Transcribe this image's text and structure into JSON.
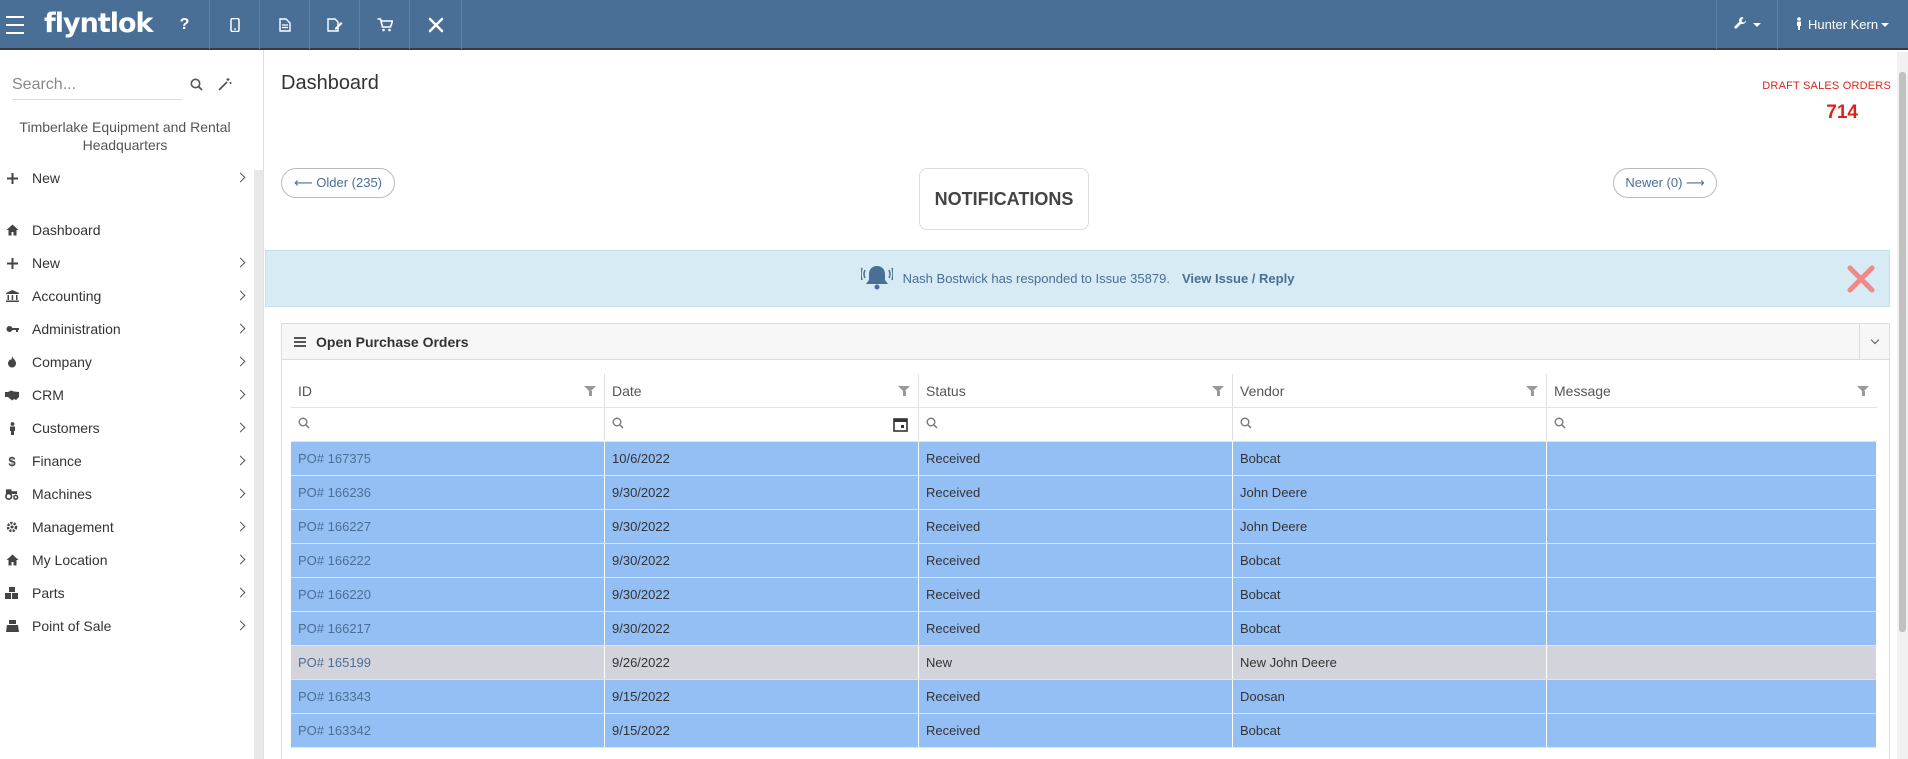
{
  "topbar": {
    "brand": "flyntlok",
    "icons": [
      "help-icon",
      "mobile-icon",
      "document-icon",
      "edit-document-icon",
      "cart-icon",
      "tools-icon"
    ],
    "help_label": "?",
    "settings_icon": "wrench-icon",
    "user_name": "Hunter Kern"
  },
  "sidebar": {
    "search_placeholder": "Search...",
    "company_name": "Timberlake Equipment and Rental Headquarters",
    "items": [
      {
        "label": "New",
        "icon": "plus-icon",
        "has_submenu": true
      },
      {
        "label": "Dashboard",
        "icon": "home-icon",
        "has_submenu": false
      },
      {
        "label": "New",
        "icon": "plus-icon",
        "has_submenu": true
      },
      {
        "label": "Accounting",
        "icon": "bank-icon",
        "has_submenu": true
      },
      {
        "label": "Administration",
        "icon": "key-icon",
        "has_submenu": true
      },
      {
        "label": "Company",
        "icon": "fire-icon",
        "has_submenu": true
      },
      {
        "label": "CRM",
        "icon": "handshake-icon",
        "has_submenu": true
      },
      {
        "label": "Customers",
        "icon": "person-icon",
        "has_submenu": true
      },
      {
        "label": "Finance",
        "icon": "dollar-icon",
        "has_submenu": true
      },
      {
        "label": "Machines",
        "icon": "tractor-icon",
        "has_submenu": true
      },
      {
        "label": "Management",
        "icon": "gear-icon",
        "has_submenu": true
      },
      {
        "label": "My Location",
        "icon": "home-icon",
        "has_submenu": true
      },
      {
        "label": "Parts",
        "icon": "boxes-icon",
        "has_submenu": true
      },
      {
        "label": "Point of Sale",
        "icon": "register-icon",
        "has_submenu": true
      }
    ]
  },
  "main": {
    "page_title": "Dashboard",
    "draft_sales_label": "DRAFT SALES ORDERS",
    "draft_sales_count": "714",
    "older_button": "⟵ Older (235)",
    "newer_button": "Newer (0) ⟶",
    "notifications_title": "NOTIFICATIONS",
    "alert": {
      "text": "Nash Bostwick has responded to Issue 35879.",
      "link": "View Issue / Reply"
    },
    "panel": {
      "title": "Open Purchase Orders",
      "columns": [
        "ID",
        "Date",
        "Status",
        "Vendor",
        "Message"
      ],
      "rows": [
        {
          "id": "PO# 167375",
          "date": "10/6/2022",
          "status": "Received",
          "vendor": "Bobcat",
          "message": "",
          "state": "selected"
        },
        {
          "id": "PO# 166236",
          "date": "9/30/2022",
          "status": "Received",
          "vendor": "John Deere",
          "message": "",
          "state": "selected"
        },
        {
          "id": "PO# 166227",
          "date": "9/30/2022",
          "status": "Received",
          "vendor": "John Deere",
          "message": "",
          "state": "selected"
        },
        {
          "id": "PO# 166222",
          "date": "9/30/2022",
          "status": "Received",
          "vendor": "Bobcat",
          "message": "",
          "state": "selected"
        },
        {
          "id": "PO# 166220",
          "date": "9/30/2022",
          "status": "Received",
          "vendor": "Bobcat",
          "message": "",
          "state": "selected"
        },
        {
          "id": "PO# 166217",
          "date": "9/30/2022",
          "status": "Received",
          "vendor": "Bobcat",
          "message": "",
          "state": "selected"
        },
        {
          "id": "PO# 165199",
          "date": "9/26/2022",
          "status": "New",
          "vendor": "New John Deere",
          "message": "",
          "state": "new"
        },
        {
          "id": "PO# 163343",
          "date": "9/15/2022",
          "status": "Received",
          "vendor": "Doosan",
          "message": "",
          "state": "selected"
        },
        {
          "id": "PO# 163342",
          "date": "9/15/2022",
          "status": "Received",
          "vendor": "Bobcat",
          "message": "",
          "state": "selected"
        }
      ]
    }
  },
  "colors": {
    "topbar": "#4a6f96",
    "selected_row": "#94bff5",
    "new_row": "#d3d3dc",
    "alert_bg": "#d6ebf4",
    "draft_red": "#d9241c"
  }
}
